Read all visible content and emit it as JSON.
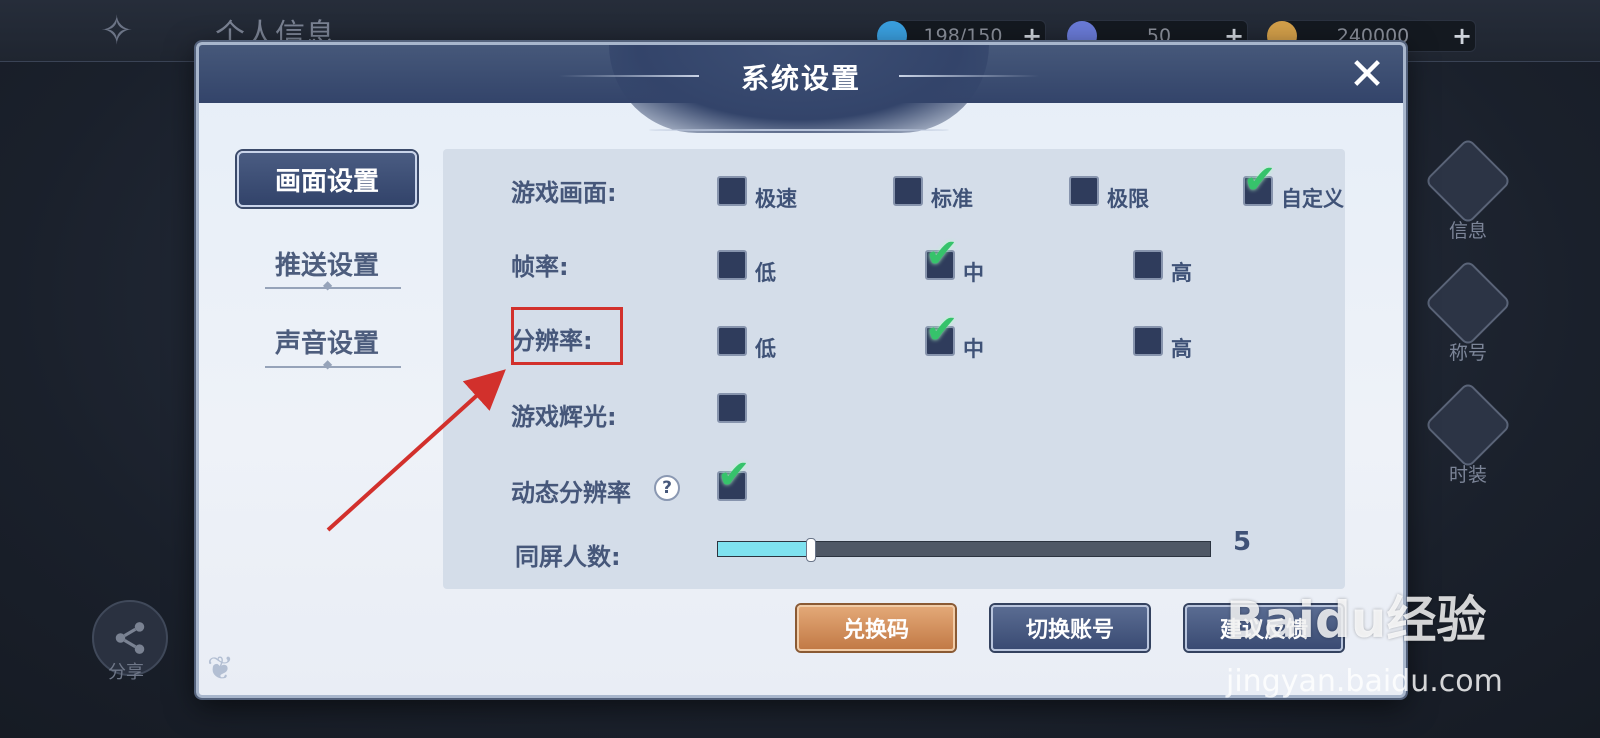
{
  "background": {
    "page_title": "个人信息",
    "resources": [
      {
        "value": "198/150",
        "plus": "+",
        "icon": "energy-icon",
        "color": "#3aa0e0"
      },
      {
        "value": "50",
        "plus": "+",
        "icon": "gem-icon",
        "color": "#6a7bd8"
      },
      {
        "value": "240000",
        "plus": "+",
        "icon": "coin-icon",
        "color": "#d4a04a"
      }
    ],
    "side_buttons": [
      {
        "label": "信息",
        "icon": "book-icon"
      },
      {
        "label": "称号",
        "icon": "title-icon"
      },
      {
        "label": "时装",
        "icon": "costume-icon"
      }
    ],
    "share_label": "分享"
  },
  "dialog": {
    "title": "系统设置",
    "close_icon": "close-icon",
    "nav": [
      {
        "label": "画面设置",
        "active": true
      },
      {
        "label": "推送设置",
        "active": false
      },
      {
        "label": "声音设置",
        "active": false
      }
    ],
    "settings": {
      "game_graphics": {
        "label": "游戏画面:",
        "options": [
          {
            "label": "极速",
            "checked": false
          },
          {
            "label": "标准",
            "checked": false
          },
          {
            "label": "极限",
            "checked": false
          },
          {
            "label": "自定义",
            "checked": true
          }
        ]
      },
      "frame_rate": {
        "label": "帧率:",
        "options": [
          {
            "label": "低",
            "checked": false
          },
          {
            "label": "中",
            "checked": true
          },
          {
            "label": "高",
            "checked": false
          }
        ]
      },
      "resolution": {
        "label": "分辨率:",
        "options": [
          {
            "label": "低",
            "checked": false
          },
          {
            "label": "中",
            "checked": true
          },
          {
            "label": "高",
            "checked": false
          }
        ]
      },
      "game_glow": {
        "label": "游戏辉光:",
        "checked": false
      },
      "dynamic_resolution": {
        "label": "动态分辨率",
        "help": "?",
        "checked": true
      },
      "players_on_screen": {
        "label": "同屏人数:",
        "value": "5",
        "fill_fraction": 0.19
      }
    },
    "buttons": {
      "redeem": "兑换码",
      "switch_account": "切换账号",
      "feedback": "建议反馈"
    }
  },
  "watermark": {
    "main": "Baidu经验",
    "sub": "jingyan.baidu.com"
  },
  "colors": {
    "accent_check": "#36c36b",
    "highlight_red": "#d2302c",
    "slider_fill": "#7fe2f0"
  }
}
